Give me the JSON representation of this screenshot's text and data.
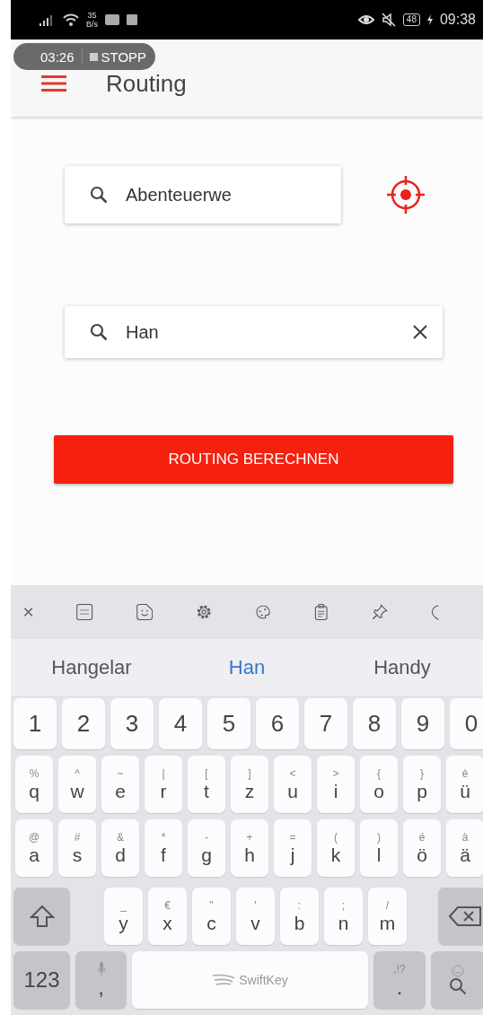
{
  "status_bar": {
    "network_speed": "35",
    "network_speed_unit": "B/s",
    "battery": "48",
    "time": "09:38"
  },
  "recording": {
    "time": "03:26",
    "action": "STOPP"
  },
  "app_bar": {
    "title": "Routing"
  },
  "start_field": {
    "value": "Abenteuerwe"
  },
  "destination_field": {
    "value": "Han"
  },
  "route_button": "ROUTING BERECHNEN",
  "keyboard": {
    "suggestions": [
      {
        "text": "Hangelar",
        "selected": false
      },
      {
        "text": "Han",
        "selected": true
      },
      {
        "text": "Handy",
        "selected": false
      }
    ],
    "number_row": [
      "1",
      "2",
      "3",
      "4",
      "5",
      "6",
      "7",
      "8",
      "9",
      "0"
    ],
    "letter_rows": [
      [
        {
          "main": "q",
          "alt": "%"
        },
        {
          "main": "w",
          "alt": "^"
        },
        {
          "main": "e",
          "alt": "~"
        },
        {
          "main": "r",
          "alt": "|"
        },
        {
          "main": "t",
          "alt": "["
        },
        {
          "main": "z",
          "alt": "]"
        },
        {
          "main": "u",
          "alt": "<"
        },
        {
          "main": "i",
          "alt": ">"
        },
        {
          "main": "o",
          "alt": "{"
        },
        {
          "main": "p",
          "alt": "}"
        },
        {
          "main": "ü",
          "alt": "è"
        }
      ],
      [
        {
          "main": "a",
          "alt": "@"
        },
        {
          "main": "s",
          "alt": "#"
        },
        {
          "main": "d",
          "alt": "&"
        },
        {
          "main": "f",
          "alt": "*"
        },
        {
          "main": "g",
          "alt": "-"
        },
        {
          "main": "h",
          "alt": "+"
        },
        {
          "main": "j",
          "alt": "="
        },
        {
          "main": "k",
          "alt": "("
        },
        {
          "main": "l",
          "alt": ")"
        },
        {
          "main": "ö",
          "alt": "é"
        },
        {
          "main": "ä",
          "alt": "à"
        }
      ],
      [
        {
          "main": "y",
          "alt": "_"
        },
        {
          "main": "x",
          "alt": "€"
        },
        {
          "main": "c",
          "alt": "\""
        },
        {
          "main": "v",
          "alt": "'"
        },
        {
          "main": "b",
          "alt": ":"
        },
        {
          "main": "n",
          "alt": ";"
        },
        {
          "main": "m",
          "alt": "/"
        }
      ]
    ],
    "symbols_key": "123",
    "comma_key": ",",
    "space_label": "SwiftKey",
    "period_key": ".",
    "period_alt": ",!?"
  }
}
